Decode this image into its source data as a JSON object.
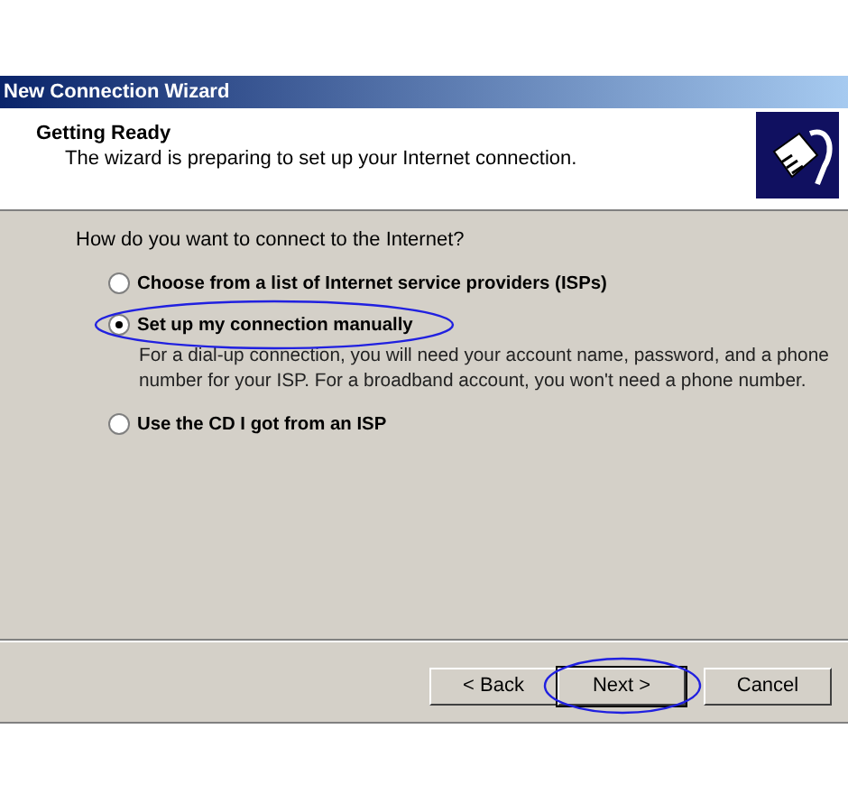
{
  "window": {
    "title": "New Connection Wizard"
  },
  "header": {
    "title": "Getting Ready",
    "subtitle": "The wizard is preparing to set up your Internet connection."
  },
  "question": "How do you want to connect to the Internet?",
  "options": [
    {
      "label": "Choose from a list of Internet service providers (ISPs)",
      "selected": false,
      "highlighted": false
    },
    {
      "label": "Set up my connection manually",
      "selected": true,
      "highlighted": true,
      "description": "For a dial-up connection, you will need your account name, password, and a phone number for your ISP. For a broadband account, you won't need a phone number."
    },
    {
      "label": "Use the CD I got from an ISP",
      "selected": false,
      "highlighted": false
    }
  ],
  "buttons": [
    {
      "label": "< Back",
      "default": false,
      "highlighted": false
    },
    {
      "label": "Next >",
      "default": true,
      "highlighted": true
    },
    {
      "label": "Cancel",
      "default": false,
      "highlighted": false
    }
  ]
}
